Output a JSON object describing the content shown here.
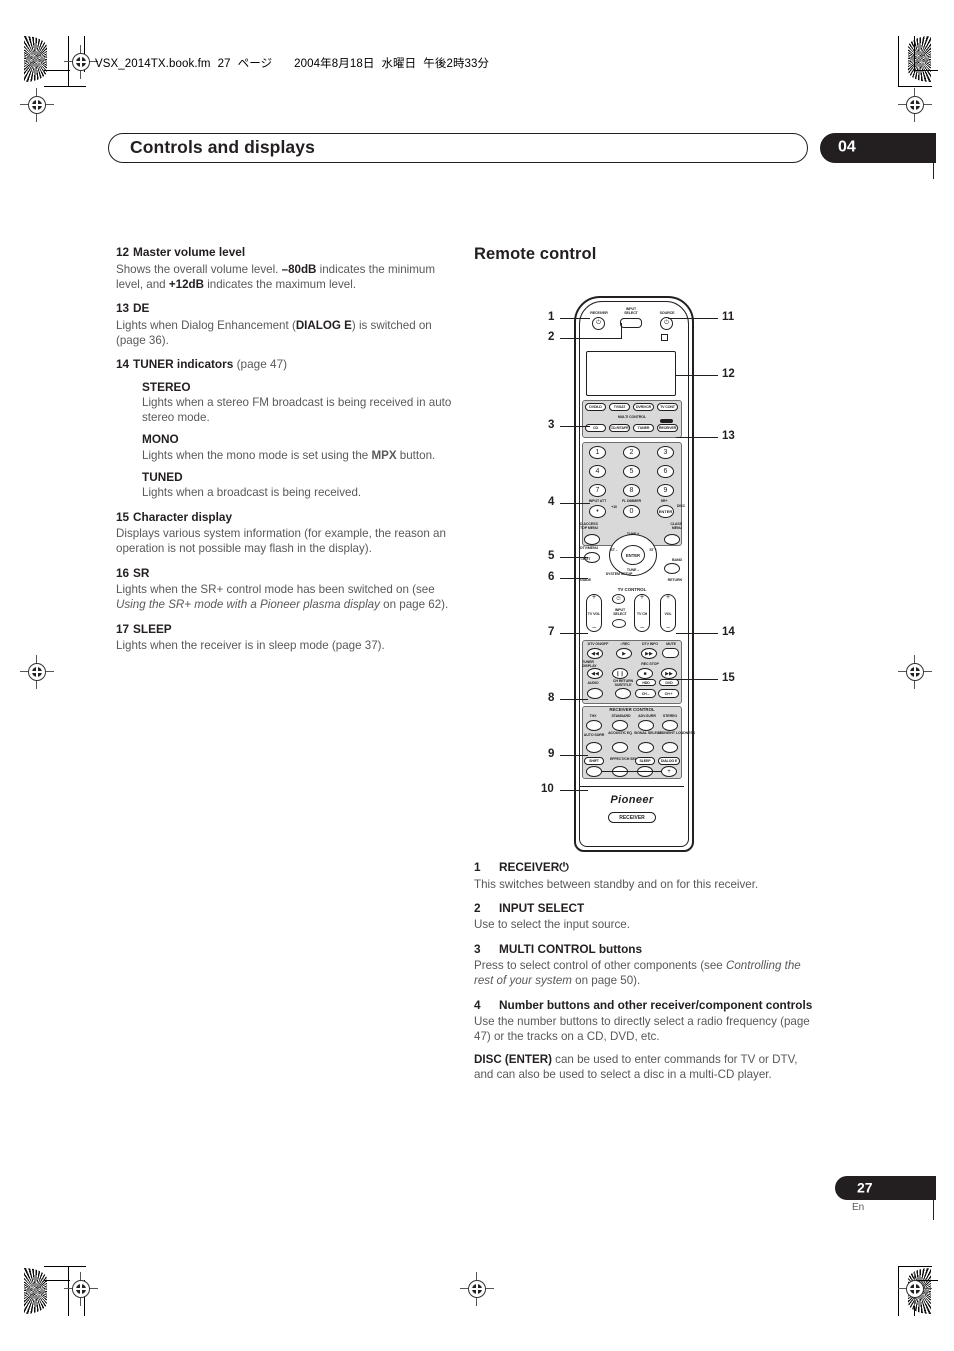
{
  "file_header": {
    "filename": "VSX_2014TX.book.fm",
    "page_label": "27",
    "page_unit": "ページ",
    "date": "2004年8月18日",
    "weekday": "水曜日",
    "time": "午後2時33分"
  },
  "header": {
    "title": "Controls and displays",
    "chapter": "04"
  },
  "footer": {
    "page_number": "27",
    "language": "En"
  },
  "left_column": [
    {
      "num": "12",
      "title": "Master volume level",
      "body_html": "Shows the overall volume level. <b>–80dB</b> indicates the minimum level, and <b>+12dB</b> indicates the maximum level."
    },
    {
      "num": "13",
      "title": "DE",
      "body_html": "Lights when Dialog Enhancement (<b>DIALOG E</b>) is switched on (page 36)."
    },
    {
      "num": "14",
      "title": "TUNER indicators",
      "title_suffix": "(page 47)",
      "subitems": [
        {
          "title": "STEREO",
          "body_html": "Lights when a stereo FM broadcast is being received in auto stereo mode."
        },
        {
          "title": "MONO",
          "body_html": "Lights when the mono mode is set using the <b>MPX</b> button."
        },
        {
          "title": "TUNED",
          "body_html": "Lights when a broadcast is being received."
        }
      ]
    },
    {
      "num": "15",
      "title": "Character display",
      "body_html": "Displays various system information (for example, the reason an operation is not possible may flash in the display)."
    },
    {
      "num": "16",
      "title": "SR",
      "body_html": "Lights when the SR+ control mode has been switched on (see <i>Using the SR+ mode with a Pioneer plasma display</i> on page 62)."
    },
    {
      "num": "17",
      "title": "SLEEP",
      "body_html": "Lights when the receiver is in sleep mode (page 37)."
    }
  ],
  "right_column": {
    "section_title": "Remote control",
    "items": [
      {
        "num": "1",
        "title": "RECEIVER⏻",
        "body_html": "This switches between standby and on for this receiver."
      },
      {
        "num": "2",
        "title": "INPUT SELECT",
        "body_html": "Use to select the input source."
      },
      {
        "num": "3",
        "title": "MULTI CONTROL buttons",
        "body_html": "Press to select control of other components (see <i>Controlling the rest of your system</i> on page 50)."
      },
      {
        "num": "4",
        "title": "Number buttons and other receiver/component controls",
        "body_html": "Use the number buttons to directly select a radio frequency (page 47) or the tracks on a CD, DVD, etc.",
        "body2_html": "<b>DISC (ENTER)</b> can be used to enter commands for TV or DTV, and can also be used to select a disc in a multi-CD player."
      }
    ]
  },
  "remote": {
    "callouts_left": [
      "1",
      "2",
      "3",
      "4",
      "5",
      "6",
      "7",
      "8",
      "9",
      "10"
    ],
    "callouts_right": [
      "11",
      "12",
      "13",
      "14",
      "15"
    ],
    "top_labels": {
      "receiver": "RECEIVER",
      "input_select": "INPUT\nSELECT",
      "source": "SOURCE"
    },
    "multi_control": {
      "group_label": "MULTI CONTROL",
      "row1": [
        "DVD/LD",
        "TV/SAT",
        "DVR/VCR",
        "TV CONT"
      ],
      "row2": [
        "CD",
        "CD-R/TAPE",
        "TUNER",
        "RECEIVER"
      ]
    },
    "numpad": {
      "keys": [
        "1",
        "2",
        "3",
        "4",
        "5",
        "6",
        "7",
        "8",
        "9"
      ],
      "row4": [
        "•",
        "0",
        "ENTER"
      ],
      "plus10": "+10",
      "disc": "DISC",
      "sub_labels": [
        "INPUT ATT",
        "FL DIMMER",
        "SR+"
      ],
      "corner_left": "D.ACCESS\nTOP MENU",
      "corner_right": "CLASS\nMENU"
    },
    "navpad": {
      "center": "ENTER",
      "up": "TUNE +",
      "down": "TUNE –",
      "left": "ST –",
      "right": "ST +",
      "left_buttons": [
        "DTV/MENU",
        "T.EDIT",
        "GUIDE",
        "SYSTEM SETUP"
      ],
      "right_buttons": [
        "BAND",
        "RETURN"
      ]
    },
    "tv_control": {
      "group_label": "TV CONTROL",
      "tv_vol": "TV VOL",
      "input_select": "INPUT\nSELECT",
      "tv_ch": "TV CH",
      "vol": "VOL"
    },
    "transport": {
      "row_labels_top": [
        "DTV ON/OFF",
        "• REC",
        "DTV INFO",
        "MUTE"
      ],
      "row2_left": "TUNER\nDISPLAY",
      "rec_stop": "REC STOP",
      "row3": [
        "AUDIO",
        "CH RETURN\nSUBTITLE",
        "HDD",
        "DVD"
      ],
      "ch_minus": "CH –",
      "ch_plus": "CH +"
    },
    "receiver_control": {
      "group_label": "RECEIVER CONTROL",
      "row1": [
        "THX",
        "STANDARD",
        "ADV.SURR",
        "STEREO"
      ],
      "row2": [
        "AUTO SURR",
        "ACOUSTIC EQ",
        "SIGNAL SELECT",
        "MIDNIGHT LOUDNESS"
      ],
      "row3": [
        "SHIFT",
        "EFFECT/CH SEL",
        "SLEEP",
        "DIALOG E"
      ]
    },
    "brand": "Pioneer",
    "bottom_badge": "RECEIVER"
  }
}
